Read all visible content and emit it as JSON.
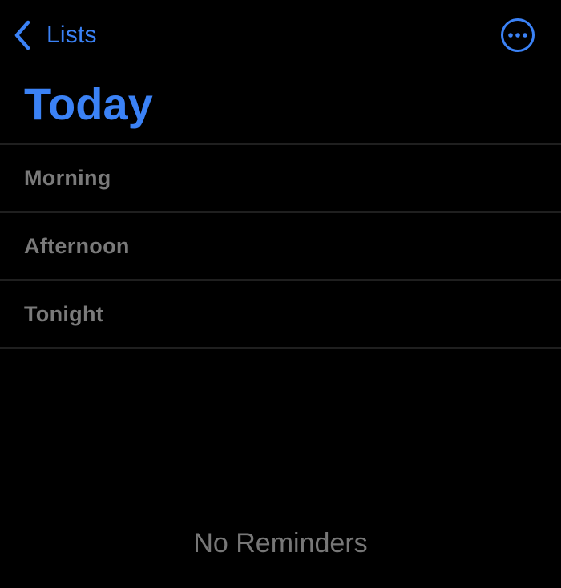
{
  "nav": {
    "back_label": "Lists",
    "back_icon": "chevron-left-icon",
    "more_icon": "ellipsis-circle-icon"
  },
  "header": {
    "title": "Today"
  },
  "sections": [
    {
      "label": "Morning"
    },
    {
      "label": "Afternoon"
    },
    {
      "label": "Tonight"
    }
  ],
  "empty_state": {
    "text": "No Reminders"
  },
  "colors": {
    "accent": "#3b82f6",
    "background": "#000000",
    "section_text": "#7a7a7a",
    "empty_text": "#777777",
    "divider": "#1f1f1f"
  }
}
